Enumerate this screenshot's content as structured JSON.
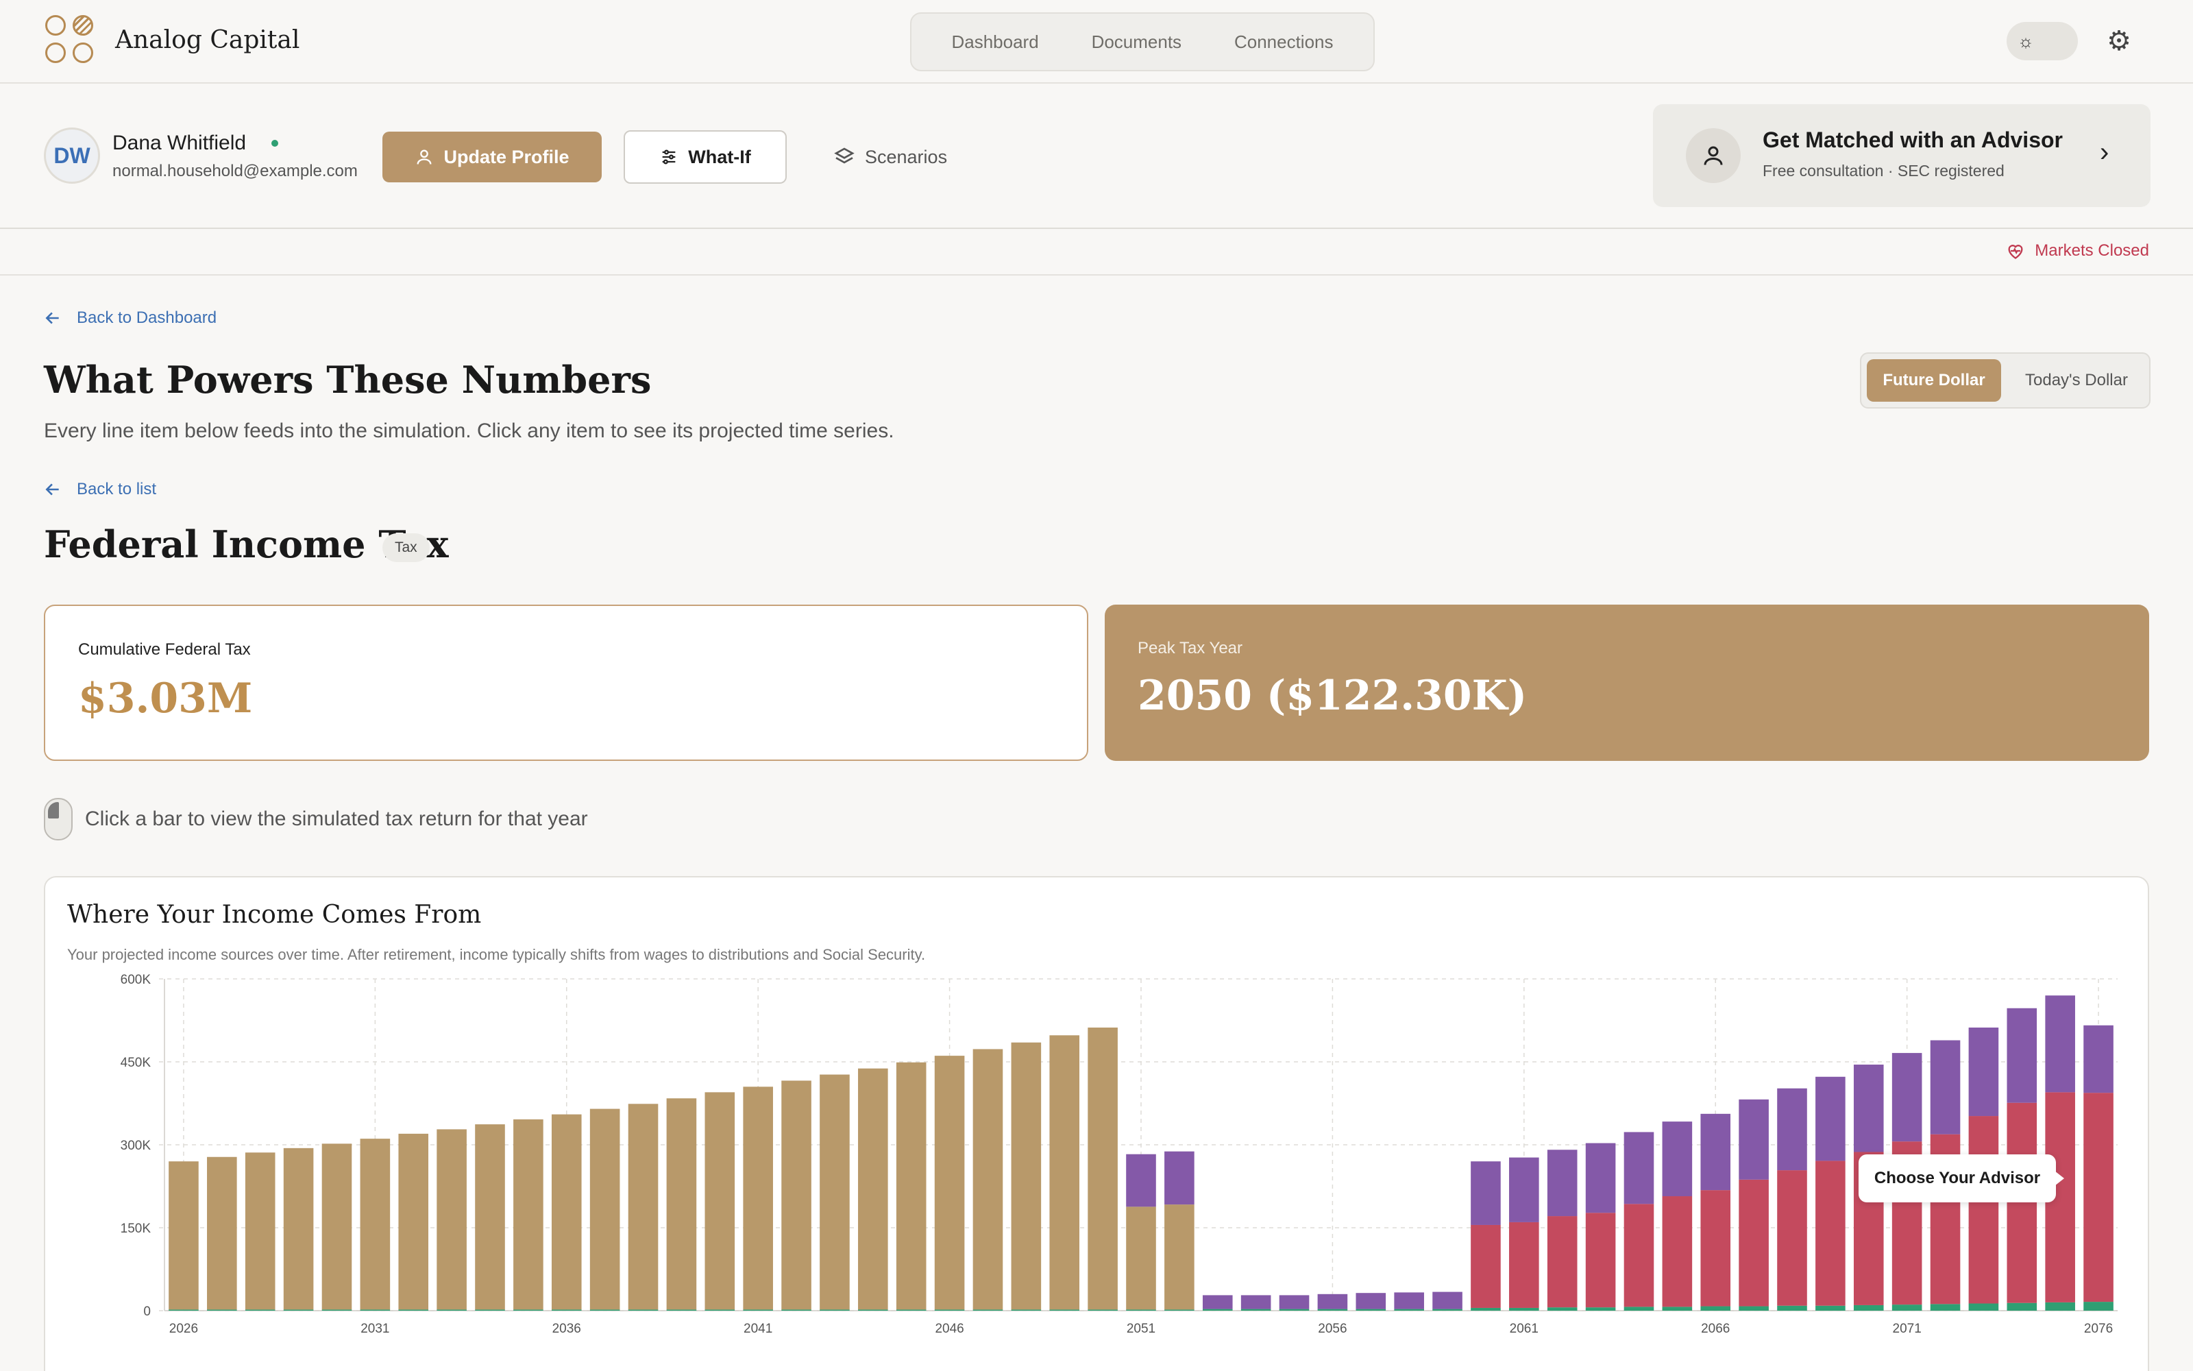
{
  "app": {
    "brand": "Analog Capital",
    "nav": [
      "Dashboard",
      "Documents",
      "Connections"
    ]
  },
  "profile": {
    "initials": "DW",
    "name": "Dana Whitfield",
    "email": "normal.household@example.com",
    "update_label": "Update Profile",
    "whatif_label": "What-If",
    "scenarios_label": "Scenarios"
  },
  "advisor": {
    "title": "Get Matched with an Advisor",
    "subtitle": "Free consultation · SEC registered"
  },
  "market_status": "Markets Closed",
  "page": {
    "back_dashboard": "Back to Dashboard",
    "title": "What Powers These Numbers",
    "subtitle": "Every line item below feeds into the simulation. Click any item to see its projected time series.",
    "dollar_toggle": {
      "selected": "Future Dollar",
      "other": "Today's Dollar"
    },
    "back_list": "Back to list",
    "item_title": "Federal Income Tax",
    "item_tag": "Tax",
    "stat1_label": "Cumulative Federal Tax",
    "stat1_value": "$3.03M",
    "stat2_label": "Peak Tax Year",
    "stat2_value": "2050 ($122.30K)",
    "hint": "Click a bar to view the simulated tax return for that year"
  },
  "tooltip": "Choose Your Advisor",
  "colors": {
    "wages": "#b8996a",
    "social_security": "#2f9f73",
    "distributions": "#c44a5e",
    "other": "#8459a8"
  },
  "chart_data": {
    "type": "bar",
    "stacked": true,
    "title": "Where Your Income Comes From",
    "subtitle": "Your projected income sources over time. After retirement, income typically shifts from wages to distributions and Social Security.",
    "x": [
      2026,
      2027,
      2028,
      2029,
      2030,
      2031,
      2032,
      2033,
      2034,
      2035,
      2036,
      2037,
      2038,
      2039,
      2040,
      2041,
      2042,
      2043,
      2044,
      2045,
      2046,
      2047,
      2048,
      2049,
      2050,
      2051,
      2052,
      2053,
      2054,
      2055,
      2056,
      2057,
      2058,
      2059,
      2060,
      2061,
      2062,
      2063,
      2064,
      2065,
      2066,
      2067,
      2068,
      2069,
      2070,
      2071,
      2072,
      2073,
      2074,
      2075,
      2076
    ],
    "x_ticks": [
      2026,
      2031,
      2036,
      2041,
      2046,
      2051,
      2056,
      2061,
      2066,
      2071,
      2076
    ],
    "y_ticks": [
      "0",
      "150K",
      "300K",
      "450K",
      "600K"
    ],
    "ylim": [
      0,
      600000
    ],
    "grid": true,
    "series": [
      {
        "color": "#2f9f73",
        "values": [
          2000,
          2000,
          2000,
          2000,
          2000,
          2000,
          2000,
          2000,
          2000,
          2000,
          2000,
          2000,
          2000,
          2000,
          2000,
          2000,
          2000,
          2000,
          2000,
          2000,
          2000,
          2000,
          2000,
          2000,
          2000,
          2000,
          2000,
          3000,
          3000,
          3000,
          3000,
          3000,
          3000,
          3000,
          5000,
          5000,
          6000,
          6000,
          7000,
          7000,
          8000,
          8000,
          9000,
          9000,
          10000,
          11000,
          12000,
          13000,
          14000,
          15000,
          16000
        ]
      },
      {
        "color": "#b8996a",
        "values": [
          268000,
          276000,
          284000,
          292000,
          300000,
          309000,
          318000,
          326000,
          335000,
          344000,
          353000,
          363000,
          372000,
          382000,
          393000,
          403000,
          414000,
          425000,
          436000,
          447000,
          459000,
          471000,
          483000,
          496000,
          510000,
          186000,
          190000,
          0,
          0,
          0,
          0,
          0,
          0,
          0,
          0,
          0,
          0,
          0,
          0,
          0,
          0,
          0,
          0,
          0,
          0,
          0,
          0,
          0,
          0,
          0,
          0
        ]
      },
      {
        "color": "#c44a5e",
        "values": [
          0,
          0,
          0,
          0,
          0,
          0,
          0,
          0,
          0,
          0,
          0,
          0,
          0,
          0,
          0,
          0,
          0,
          0,
          0,
          0,
          0,
          0,
          0,
          0,
          0,
          0,
          0,
          0,
          0,
          0,
          0,
          0,
          0,
          0,
          150000,
          155000,
          165000,
          171000,
          186000,
          200000,
          210000,
          229000,
          245000,
          262000,
          277000,
          295000,
          307000,
          339000,
          362000,
          380000,
          378000
        ]
      },
      {
        "color": "#8459a8",
        "values": [
          0,
          0,
          0,
          0,
          0,
          0,
          0,
          0,
          0,
          0,
          0,
          0,
          0,
          0,
          0,
          0,
          0,
          0,
          0,
          0,
          0,
          0,
          0,
          0,
          0,
          95000,
          96000,
          25000,
          25000,
          25000,
          27000,
          29000,
          30000,
          31000,
          115000,
          117000,
          120000,
          126000,
          130000,
          135000,
          138000,
          145000,
          148000,
          152000,
          158000,
          160000,
          170000,
          160000,
          171000,
          175000,
          122000
        ]
      }
    ]
  }
}
